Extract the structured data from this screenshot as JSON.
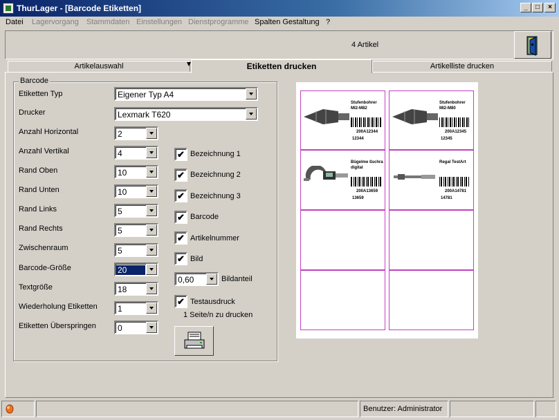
{
  "window": {
    "title": "ThurLager - [Barcode Etiketten]"
  },
  "menu": [
    "Datei",
    "Lagervorgang",
    "Stammdaten",
    "Einstellungen",
    "Dienstprogramme",
    "Spalten Gestaltung",
    "?"
  ],
  "header": {
    "count": "4 Artikel"
  },
  "tabs": [
    "Artikelauswahl",
    "Etiketten drucken",
    "Artikelliste drucken"
  ],
  "group": {
    "title": "Barcode"
  },
  "fields": {
    "etiketten_typ": {
      "label": "Etiketten Typ",
      "value": "Eigener Typ A4"
    },
    "drucker": {
      "label": "Drucker",
      "value": "Lexmark T620"
    },
    "anzahl_horizontal": {
      "label": "Anzahl Horizontal",
      "value": "2"
    },
    "anzahl_vertikal": {
      "label": "Anzahl Vertikal",
      "value": "4"
    },
    "rand_oben": {
      "label": "Rand Oben",
      "value": "10"
    },
    "rand_unten": {
      "label": "Rand Unten",
      "value": "10"
    },
    "rand_links": {
      "label": "Rand Links",
      "value": "5"
    },
    "rand_rechts": {
      "label": "Rand Rechts",
      "value": "5"
    },
    "zwischenraum": {
      "label": "Zwischenraum",
      "value": "5"
    },
    "barcode_groesse": {
      "label": "Barcode-Größe",
      "value": "20"
    },
    "textgroesse": {
      "label": "Textgröße",
      "value": "18"
    },
    "wiederholung": {
      "label": "Wiederholung Etiketten",
      "value": "1"
    },
    "ueberspringen": {
      "label": "Etiketten Überspringen",
      "value": "0"
    }
  },
  "checks": {
    "bez1": {
      "label": "Bezeichnung 1",
      "checked": true
    },
    "bez2": {
      "label": "Bezeichnung 2",
      "checked": true
    },
    "bez3": {
      "label": "Bezeichnung 3",
      "checked": true
    },
    "barcode": {
      "label": "Barcode",
      "checked": true
    },
    "artikelnummer": {
      "label": "Artikelnummer",
      "checked": true
    },
    "bild": {
      "label": "Bild",
      "checked": true
    },
    "testausdruck": {
      "label": "Testausdruck",
      "checked": true
    },
    "check_mark": "✔"
  },
  "bildanteil": {
    "value": "0,60",
    "label": "Bildanteil"
  },
  "pages_info": "1 Seite/n zu drucken",
  "labels": [
    {
      "name1": "Stufenbohrer",
      "name2": "MI2-M82",
      "code": "200A12344",
      "nr": "12344"
    },
    {
      "name1": "Stufenbohrer",
      "name2": "MI2-M80",
      "code": "200A12345",
      "nr": "12345"
    },
    {
      "name1": "Bügelme ßschra",
      "name2": "digital",
      "code": "200A13659",
      "nr": "13659"
    },
    {
      "name1": "Regal TestArt",
      "name2": "",
      "code": "200A14781",
      "nr": "14781"
    }
  ],
  "status": {
    "user": "Benutzer: Administrator"
  }
}
